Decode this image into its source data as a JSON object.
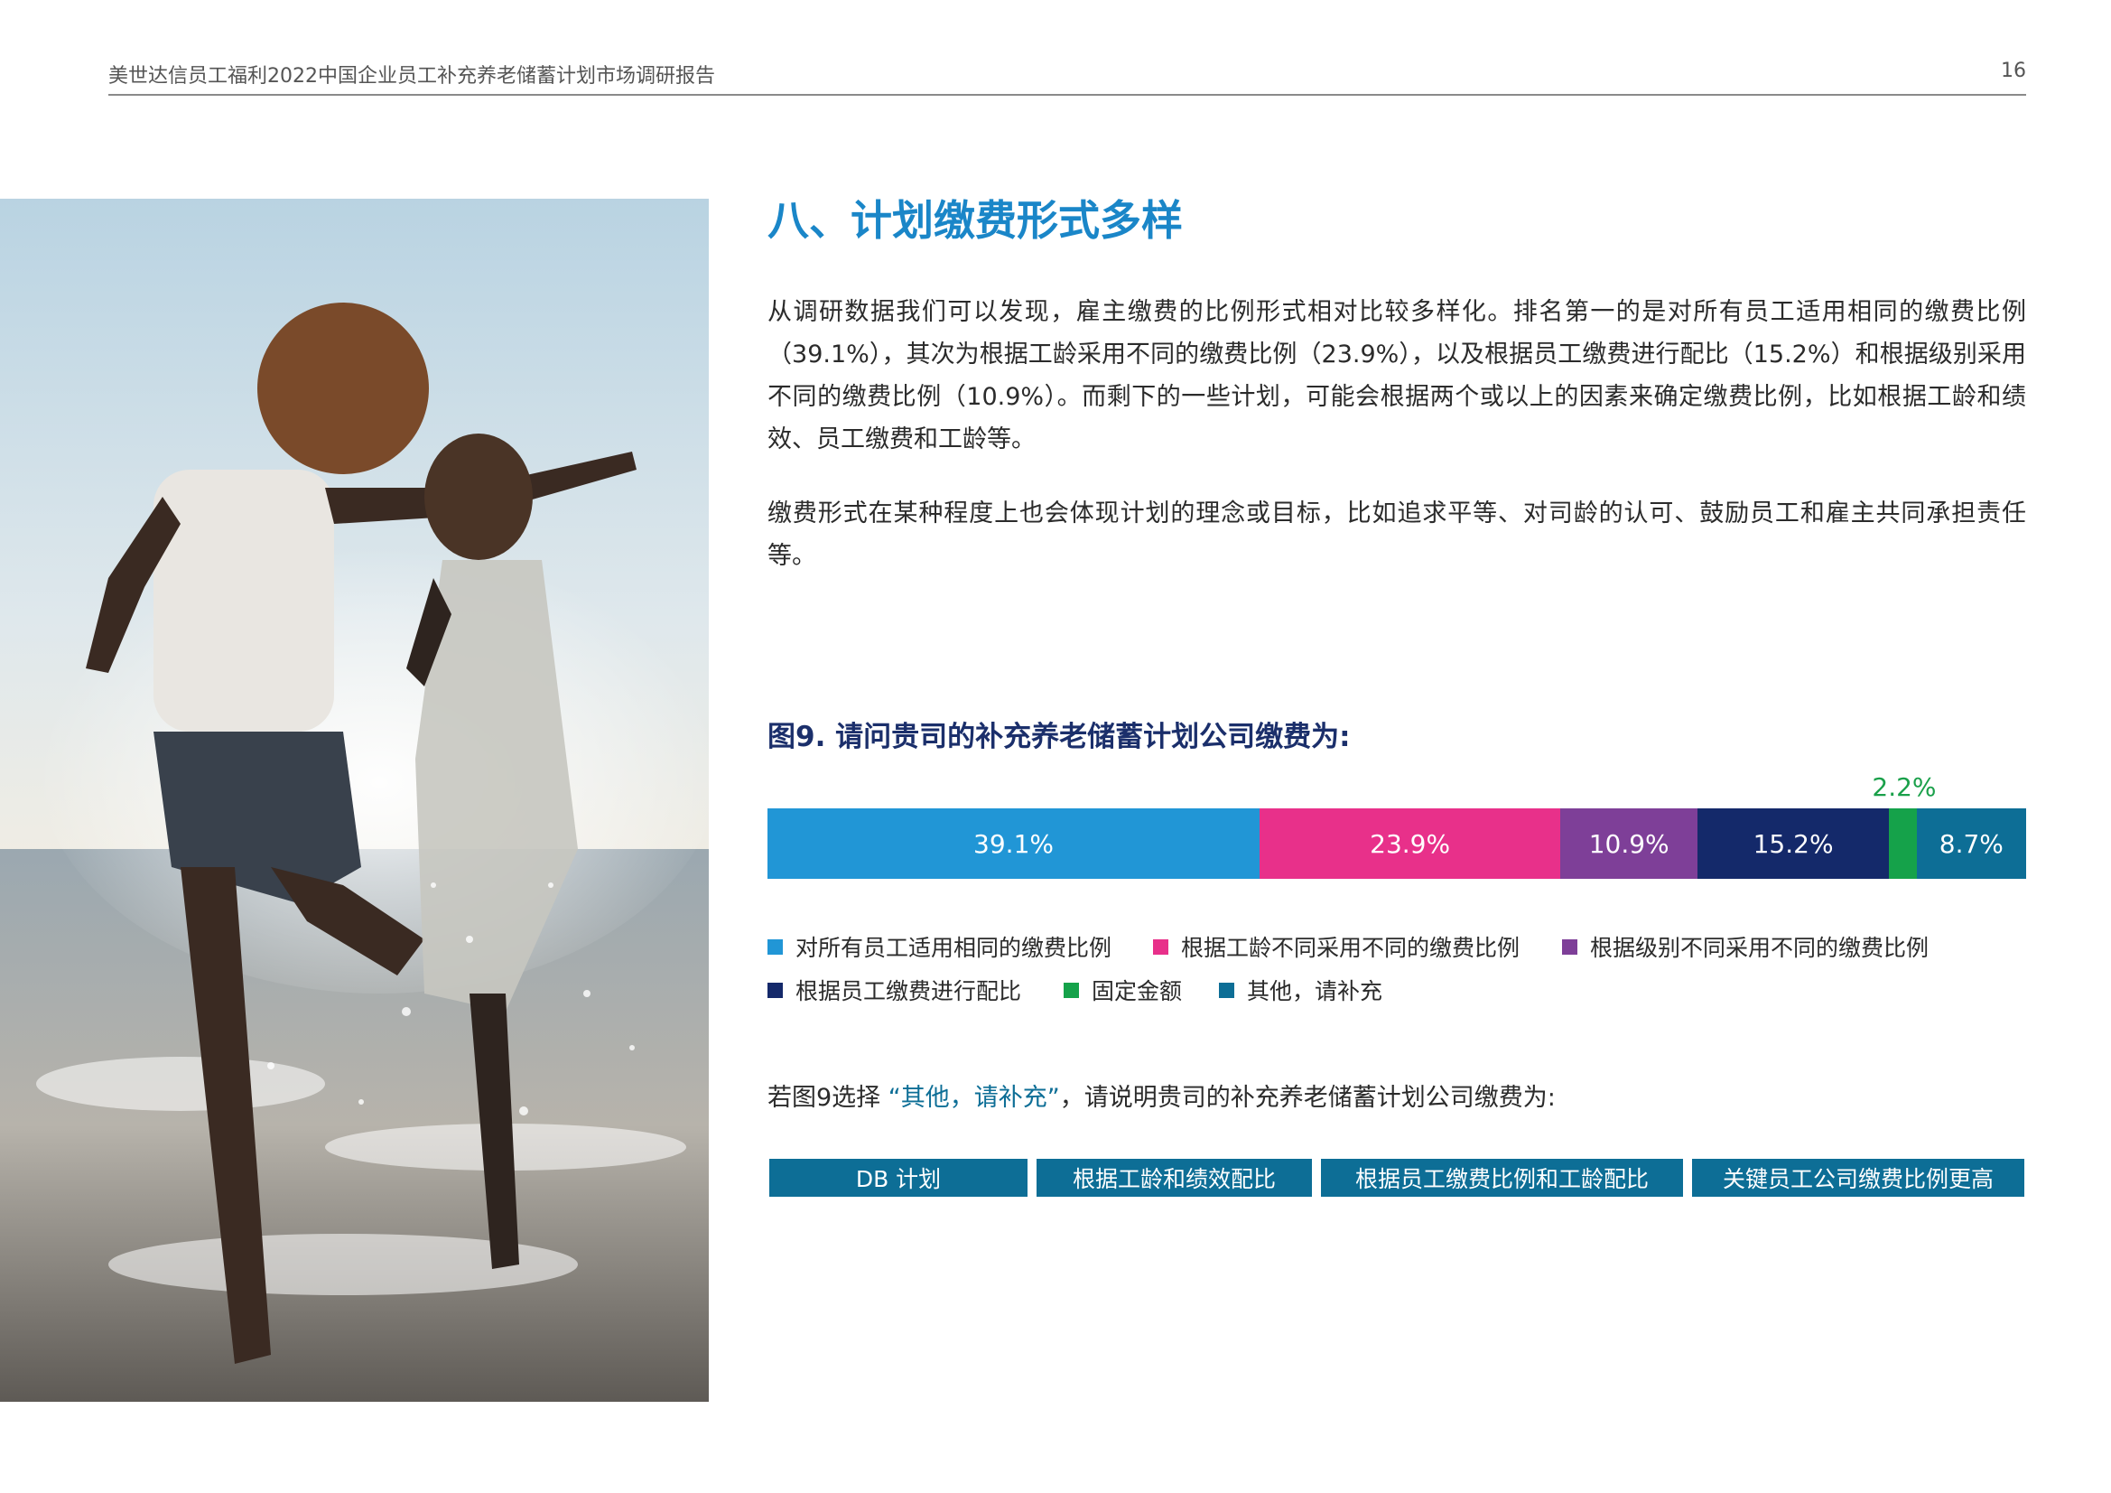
{
  "header": {
    "title": "美世达信员工福利2022中国企业员工补充养老储蓄计划市场调研报告",
    "page_number": "16"
  },
  "section": {
    "title": "八、计划缴费形式多样",
    "paragraph1": "从调研数据我们可以发现，雇主缴费的比例形式相对比较多样化。排名第一的是对所有员工适用相同的缴费比例（39.1%），其次为根据工龄采用不同的缴费比例（23.9%），以及根据员工缴费进行配比（15.2%）和根据级别采用不同的缴费比例（10.9%）。而剩下的一些计划，可能会根据两个或以上的因素来确定缴费比例，比如根据工龄和绩效、员工缴费和工龄等。",
    "paragraph2": "缴费形式在某种程度上也会体现计划的理念或目标，比如追求平等、对司龄的认可、鼓励员工和雇主共同承担责任等。"
  },
  "chart_data": {
    "type": "bar",
    "stacked": true,
    "orientation": "horizontal",
    "title": "图9. 请问贵司的补充养老储蓄计划公司缴费为:",
    "series": [
      {
        "name": "对所有员工适用相同的缴费比例",
        "value": 39.1,
        "label": "39.1%",
        "color": "#2196d6"
      },
      {
        "name": "根据工龄不同采用不同的缴费比例",
        "value": 23.9,
        "label": "23.9%",
        "color": "#e8308a"
      },
      {
        "name": "根据级别不同采用不同的缴费比例",
        "value": 10.9,
        "label": "10.9%",
        "color": "#7e3f98"
      },
      {
        "name": "根据员工缴费进行配比",
        "value": 15.2,
        "label": "15.2%",
        "color": "#14296a"
      },
      {
        "name": "固定金额",
        "value": 2.2,
        "label": "2.2%",
        "color": "#15a24a"
      },
      {
        "name": "其他，请补充",
        "value": 8.7,
        "label": "8.7%",
        "color": "#0d6e96"
      }
    ],
    "legend_position": "bottom"
  },
  "question": {
    "prefix": "若图9选择 ",
    "highlight": "“其他，请补充”",
    "suffix": "，请说明贵司的补充养老储蓄计划公司缴费为:"
  },
  "tags": [
    "DB 计划",
    "根据工龄和绩效配比",
    "根据员工缴费比例和工龄配比",
    "关键员工公司缴费比例更高"
  ]
}
